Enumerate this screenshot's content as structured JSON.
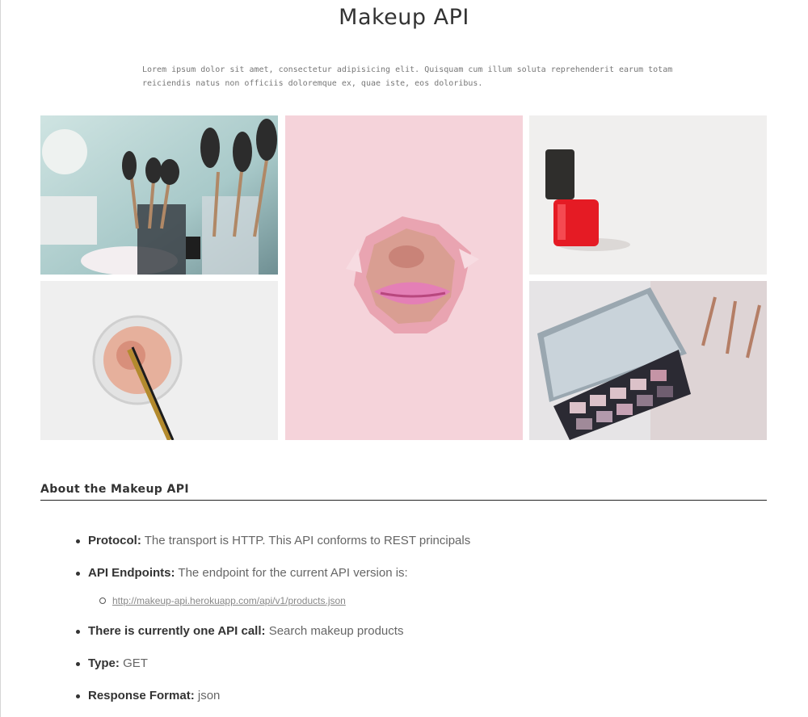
{
  "page": {
    "title": "Makeup API",
    "intro": "Lorem ipsum dolor sit amet, consectetur adipisicing elit. Quisquam cum illum soluta reprehenderit earum totam reiciendis natus non officiis doloremque ex, quae iste, eos doloribus."
  },
  "gallery": [
    {
      "subject": "makeup brushes in jars"
    },
    {
      "subject": "face through torn pink paper"
    },
    {
      "subject": "red nail polish bottle"
    },
    {
      "subject": "loose powder with brush"
    },
    {
      "subject": "eyeshadow palette with mirror"
    }
  ],
  "about": {
    "heading": "About the Makeup API",
    "items": [
      {
        "label": "Protocol:",
        "text": "The transport is HTTP. This API conforms to REST principals"
      },
      {
        "label": "API Endpoints:",
        "text": "The endpoint for the current API version is:"
      },
      {
        "link": "http://makeup-api.herokuapp.com/api/v1/products.json"
      },
      {
        "label": "There is currently one API call:",
        "text": "Search makeup products"
      },
      {
        "label": "Type:",
        "text": "GET"
      },
      {
        "label": "Response Format:",
        "text": "json"
      }
    ]
  }
}
